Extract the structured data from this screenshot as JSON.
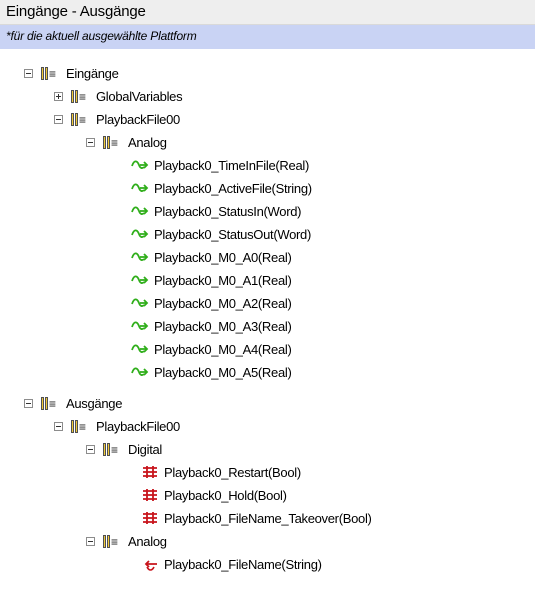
{
  "window": {
    "title": "Eingänge - Ausgänge"
  },
  "subtitle": "*für die aktuell ausgewählte Plattform",
  "inputs": {
    "root": "Eingänge",
    "global": "GlobalVariables",
    "file": "PlaybackFile00",
    "group": "Analog",
    "items": [
      "Playback0_TimeInFile(Real)",
      "Playback0_ActiveFile(String)",
      "Playback0_StatusIn(Word)",
      "Playback0_StatusOut(Word)",
      "Playback0_M0_A0(Real)",
      "Playback0_M0_A1(Real)",
      "Playback0_M0_A2(Real)",
      "Playback0_M0_A3(Real)",
      "Playback0_M0_A4(Real)",
      "Playback0_M0_A5(Real)"
    ]
  },
  "outputs": {
    "root": "Ausgänge",
    "file": "PlaybackFile00",
    "digital_group": "Digital",
    "digital_items": [
      "Playback0_Restart(Bool)",
      "Playback0_Hold(Bool)",
      "Playback0_FileName_Takeover(Bool)"
    ],
    "analog_group": "Analog",
    "analog_items": [
      "Playback0_FileName(String)"
    ]
  },
  "colors": {
    "subtitle_bg": "#c9d3f4",
    "analog_input_icon": "#2fae1a",
    "digital_output_icon": "#c8141c",
    "analog_output_icon": "#c8141c"
  },
  "icons": {
    "expander": "tree-expander-icon",
    "folder": "variable-folder-icon",
    "analog_input": "analog-input-icon",
    "digital_output": "digital-output-icon",
    "analog_output": "analog-output-icon"
  }
}
